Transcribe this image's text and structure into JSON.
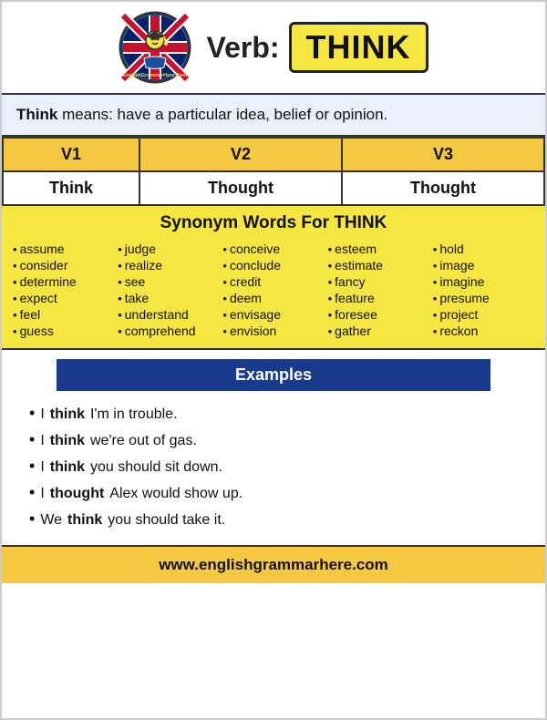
{
  "header": {
    "verb_label": "Verb:",
    "verb_word": "THINK"
  },
  "definition": {
    "bold_word": "Think",
    "text": " means: have a particular idea, belief or opinion."
  },
  "verb_forms": {
    "headers": [
      "V1",
      "V2",
      "V3"
    ],
    "values": [
      "Think",
      "Thought",
      "Thought"
    ]
  },
  "synonyms": {
    "title_prefix": "Synonym Words For ",
    "title_word": "THINK",
    "columns": [
      [
        "assume",
        "consider",
        "determine",
        "expect",
        "feel",
        "guess"
      ],
      [
        "judge",
        "realize",
        "see",
        "take",
        "understand",
        "comprehend"
      ],
      [
        "conceive",
        "conclude",
        "credit",
        "deem",
        "envisage",
        "envision"
      ],
      [
        "esteem",
        "estimate",
        "fancy",
        "feature",
        "foresee",
        "gather"
      ],
      [
        "hold",
        "image",
        "imagine",
        "presume",
        "project",
        "reckon"
      ]
    ]
  },
  "examples": {
    "header": "Examples",
    "items": [
      {
        "prefix": "I ",
        "bold": "think",
        "suffix": " I'm in trouble."
      },
      {
        "prefix": "I ",
        "bold": "think",
        "suffix": " we're out of gas."
      },
      {
        "prefix": "I ",
        "bold": "think",
        "suffix": " you should sit down."
      },
      {
        "prefix": "I ",
        "bold": "thought",
        "suffix": " Alex would show up."
      },
      {
        "prefix": "We ",
        "bold": "think",
        "suffix": " you should take it."
      }
    ]
  },
  "footer": {
    "url": "www.englishgrammarhere.com"
  }
}
